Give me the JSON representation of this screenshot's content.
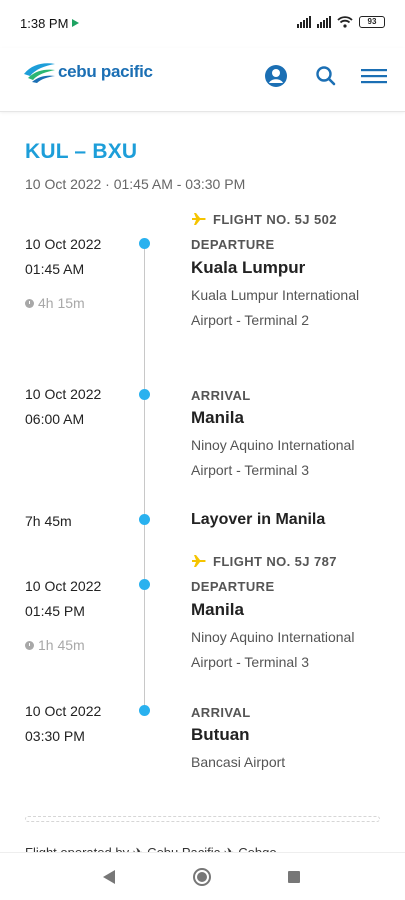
{
  "status_bar": {
    "time": "1:38 PM",
    "battery": "93"
  },
  "header": {
    "logo_text": "cebu pacific"
  },
  "trip": {
    "route": "KUL – BXU",
    "datetime": "10 Oct 2022 · 01:45 AM - 03:30 PM"
  },
  "segments": [
    {
      "flight_no": "FLIGHT NO. 5J 502",
      "departure": {
        "date": "10 Oct 2022",
        "time": "01:45 AM",
        "label": "DEPARTURE",
        "city": "Kuala Lumpur",
        "airport": "Kuala Lumpur International Airport - Terminal 2"
      },
      "duration": "4h 15m",
      "arrival": {
        "date": "10 Oct 2022",
        "time": "06:00 AM",
        "label": "ARRIVAL",
        "city": "Manila",
        "airport": "Ninoy Aquino International Airport - Terminal 3"
      }
    },
    {
      "flight_no": "FLIGHT NO. 5J 787",
      "departure": {
        "date": "10 Oct 2022",
        "time": "01:45 PM",
        "label": "DEPARTURE",
        "city": "Manila",
        "airport": "Ninoy Aquino International Airport - Terminal 3"
      },
      "duration": "1h 45m",
      "arrival": {
        "date": "10 Oct 2022",
        "time": "03:30 PM",
        "label": "ARRIVAL",
        "city": "Butuan",
        "airport": "Bancasi Airport"
      }
    }
  ],
  "layover": {
    "duration": "7h 45m",
    "text": "Layover in Manila"
  },
  "footer": {
    "operated_by": "Flight operated by  ✈ Cebu Pacific  ✈ Cebgo"
  },
  "colors": {
    "accent": "#1d9ed9",
    "brand": "#1b6fb4",
    "dot": "#29b1ef",
    "plane": "#f5c400"
  }
}
